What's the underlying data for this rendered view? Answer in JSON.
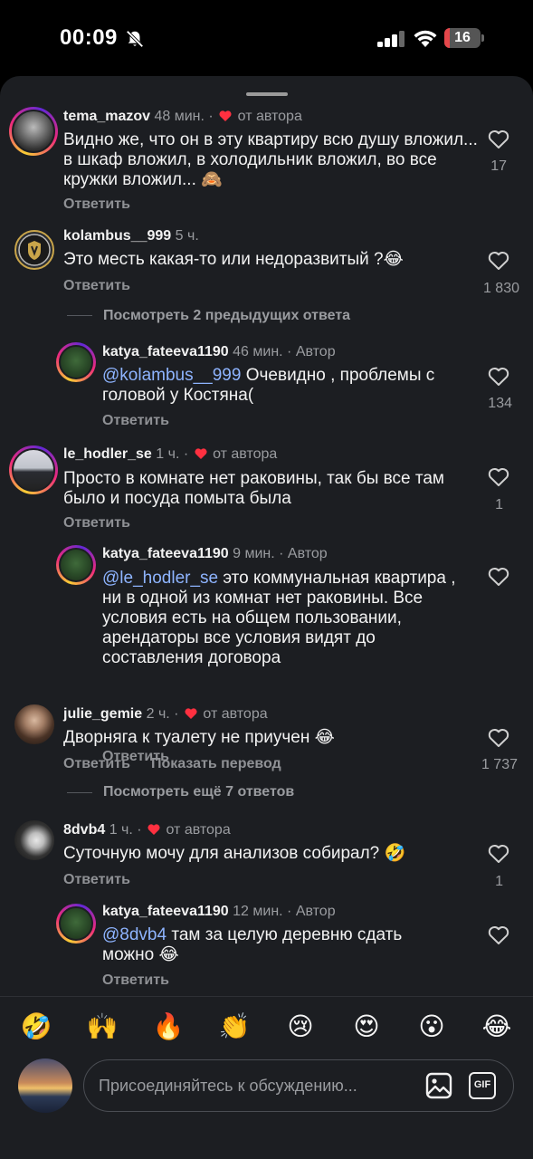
{
  "status": {
    "time": "00:09",
    "battery": "16",
    "battery_level": 0.16
  },
  "comments": [
    {
      "user": "tema_mazov",
      "time": "48 мин.",
      "badge": "от автора",
      "text": "Видно же, что он в эту квартиру всю душу вложил... в шкаф вложил, в холодильник вложил, во все кружки вложил... 🙈",
      "reply_label": "Ответить",
      "likes": "17"
    },
    {
      "user": "kolambus__999",
      "time": "5 ч.",
      "text": "Это месть какая-то или недоразвитый ?😂",
      "reply_label": "Ответить",
      "likes": "1 830"
    },
    {
      "user": "katya_fateeva1190",
      "time": "46 мин.",
      "badge": "Автор",
      "mention": "@kolambus__999",
      "text": " Очевидно , проблемы с головой у Костяна(",
      "reply_label": "Ответить",
      "likes": "134"
    },
    {
      "user": "le_hodler_se",
      "time": "1 ч.",
      "badge": "от автора",
      "text": "Просто в комнате нет раковины, так бы все там было и посуда помыта была",
      "reply_label": "Ответить",
      "likes": "1"
    },
    {
      "user": "katya_fateeva1190",
      "time": "9 мин.",
      "badge": "Автор",
      "mention": "@le_hodler_se",
      "text": " это коммунальная квартира , ни в одной из комнат нет раковины. Все условия есть на общем пользовании, арендаторы все условия видят до составления договора",
      "reply_label": "Ответить",
      "likes": ""
    },
    {
      "user": "julie_gemie",
      "time": "2 ч.",
      "badge": "от автора",
      "text": "Дворняга к туалету не приучен 😂",
      "reply_label": "Ответить",
      "translate_label": "Показать перевод",
      "likes": "1 737"
    },
    {
      "user": "8dvb4",
      "time": "1 ч.",
      "badge": "от автора",
      "text": "Суточную мочу для анализов собирал? 🤣",
      "reply_label": "Ответить",
      "likes": "1"
    },
    {
      "user": "katya_fateeva1190",
      "time": "12 мин.",
      "badge": "Автор",
      "mention": "@8dvb4",
      "text": " там за целую деревню сдать можно 😂",
      "reply_label": "Ответить",
      "likes": ""
    }
  ],
  "thread_links": {
    "previous": "Посмотреть 2 предыдущих ответа",
    "more": "Посмотреть ещё 7 ответов"
  },
  "emojis": [
    "🤣",
    "🙌",
    "🔥",
    "👏",
    "😢",
    "😍",
    "😮",
    "😂"
  ],
  "composer": {
    "placeholder": "Присоединяйтесь к обсуждению...",
    "gif_label": "GIF"
  },
  "icons": {
    "status": [
      "bell-off-icon",
      "signal-icon",
      "wifi-icon",
      "battery-icon"
    ],
    "like": "heart-outline-icon",
    "badge_heart": "heart-icon",
    "composer": [
      "image-icon",
      "gif-icon"
    ]
  },
  "colors": {
    "background": "#1c1e22",
    "mention": "#8eb4ff",
    "heart": "#ff3040",
    "muted": "#9a9ca0"
  }
}
